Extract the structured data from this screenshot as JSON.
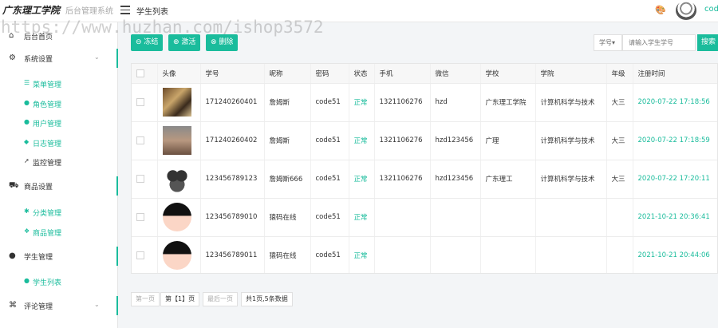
{
  "header": {
    "brand": "广东理工学院",
    "brand_sub": "后台管理系统",
    "breadcrumb": "学生列表",
    "user": "cod"
  },
  "watermark": "https://www.huzhan.com/ishop3572",
  "sidebar": {
    "home": "后台首页",
    "system": "系统设置",
    "menu_mgmt": "菜单管理",
    "role_mgmt": "角色管理",
    "user_mgmt": "用户管理",
    "log_mgmt": "日志管理",
    "monitor_mgmt": "监控管理",
    "goods_settings": "商品设置",
    "category_mgmt": "分类管理",
    "goods_mgmt": "商品管理",
    "student_mgmt": "学生管理",
    "student_list": "学生列表",
    "comment_mgmt": "评论管理"
  },
  "toolbar": {
    "freeze": "冻结",
    "activate": "激活",
    "delete": "删除",
    "search_field": "学号▾",
    "search_placeholder": "请输入学生学号",
    "search_btn": "搜索"
  },
  "table": {
    "columns": [
      "头像",
      "学号",
      "昵称",
      "密码",
      "状态",
      "手机",
      "微信",
      "学校",
      "学院",
      "年级",
      "注册时间"
    ],
    "rows": [
      {
        "avatar": "photo1",
        "sid": "171240260401",
        "nick": "詹姆斯",
        "pwd": "code51",
        "status": "正常",
        "phone": "1321106276",
        "wechat": "hzd",
        "school": "广东理工学院",
        "college": "计算机科学与技术",
        "grade": "大三",
        "time": "2020-07-22 17:18:56"
      },
      {
        "avatar": "photo2",
        "sid": "171240260402",
        "nick": "詹姆斯",
        "pwd": "code51",
        "status": "正常",
        "phone": "1321106276",
        "wechat": "hzd123456",
        "school": "广理",
        "college": "计算机科学与技术",
        "grade": "大三",
        "time": "2020-07-22 17:18:59"
      },
      {
        "avatar": "heart",
        "sid": "123456789123",
        "nick": "詹姆斯666",
        "pwd": "code51",
        "status": "正常",
        "phone": "1321106276",
        "wechat": "hzd123456",
        "school": "广东理工",
        "college": "计算机科学与技术",
        "grade": "大三",
        "time": "2020-07-22 17:20:11"
      },
      {
        "avatar": "mask",
        "sid": "123456789010",
        "nick": "猿码在线",
        "pwd": "code51",
        "status": "正常",
        "phone": "",
        "wechat": "",
        "school": "",
        "college": "",
        "grade": "",
        "time": "2021-10-21 20:36:41"
      },
      {
        "avatar": "mask",
        "sid": "123456789011",
        "nick": "猿码在线",
        "pwd": "code51",
        "status": "正常",
        "phone": "",
        "wechat": "",
        "school": "",
        "college": "",
        "grade": "",
        "time": "2021-10-21 20:44:06"
      }
    ]
  },
  "pagination": {
    "first": "第一页",
    "current": "第【1】页",
    "last": "最后一页",
    "summary": "共1页,5条数据"
  },
  "colors": {
    "accent": "#1abc9c"
  }
}
